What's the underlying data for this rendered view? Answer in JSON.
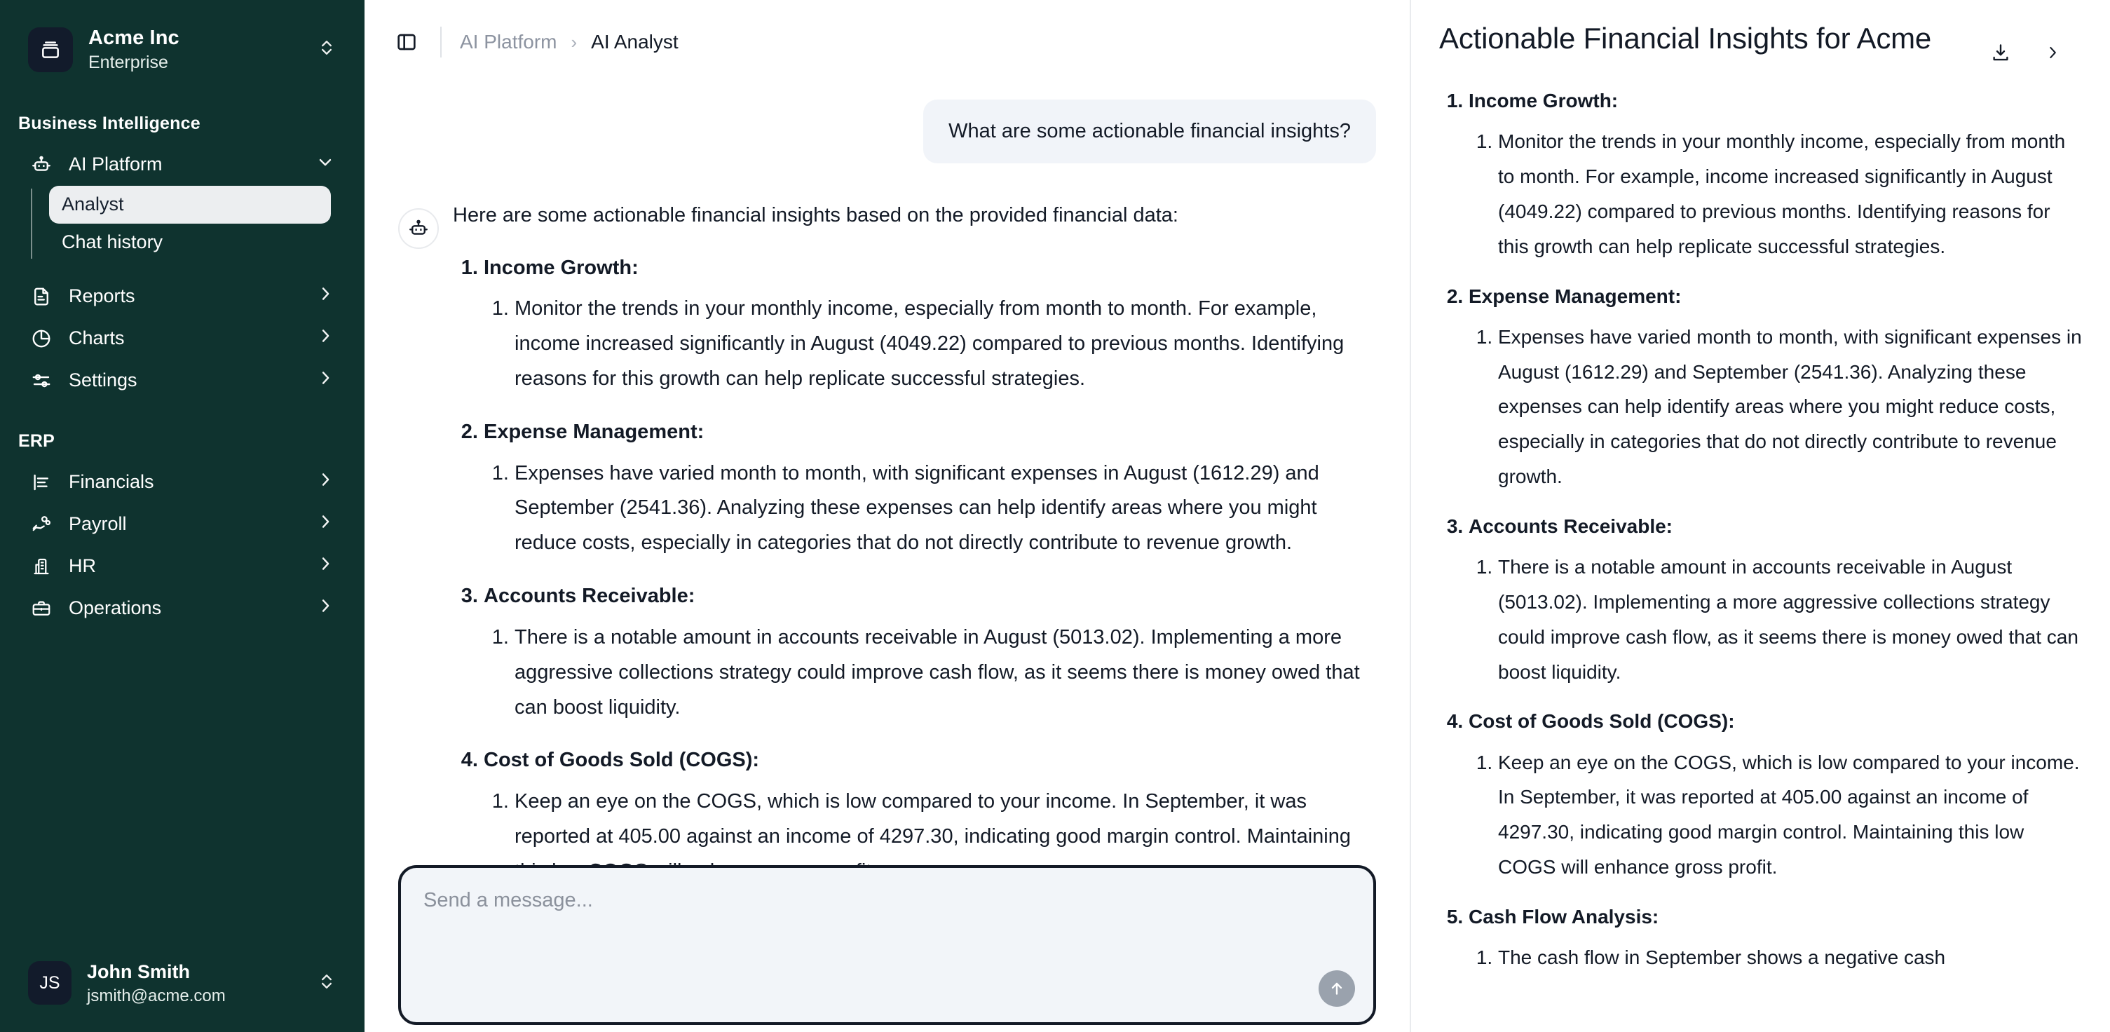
{
  "sidebar": {
    "org": {
      "name": "Acme Inc",
      "plan": "Enterprise",
      "logo_icon": "archive-box-icon",
      "switch_icon": "chevron-up-down-icon"
    },
    "sections": [
      {
        "label": "Business Intelligence",
        "items": [
          {
            "label": "AI Platform",
            "icon": "robot-icon",
            "chevron": "chevron-down-icon",
            "expanded": true,
            "children": [
              {
                "label": "Analyst",
                "active": true
              },
              {
                "label": "Chat history",
                "active": false
              }
            ]
          },
          {
            "label": "Reports",
            "icon": "document-icon",
            "chevron": "chevron-right-icon",
            "expanded": false
          },
          {
            "label": "Charts",
            "icon": "pie-chart-icon",
            "chevron": "chevron-right-icon",
            "expanded": false
          },
          {
            "label": "Settings",
            "icon": "sliders-icon",
            "chevron": "chevron-right-icon",
            "expanded": false
          }
        ]
      },
      {
        "label": "ERP",
        "items": [
          {
            "label": "Financials",
            "icon": "bar-chart-icon",
            "chevron": "chevron-right-icon",
            "expanded": false
          },
          {
            "label": "Payroll",
            "icon": "hand-coins-icon",
            "chevron": "chevron-right-icon",
            "expanded": false
          },
          {
            "label": "HR",
            "icon": "building-icon",
            "chevron": "chevron-right-icon",
            "expanded": false
          },
          {
            "label": "Operations",
            "icon": "briefcase-icon",
            "chevron": "chevron-right-icon",
            "expanded": false
          }
        ]
      }
    ],
    "user": {
      "initials": "JS",
      "name": "John Smith",
      "email": "jsmith@acme.com",
      "switch_icon": "chevron-up-down-icon"
    }
  },
  "topbar": {
    "panel_toggle_icon": "sidebar-panel-icon",
    "breadcrumb": {
      "parent": "AI Platform",
      "separator": "›",
      "current": "AI Analyst"
    }
  },
  "chat": {
    "user_message": "What are some actionable financial insights?",
    "bot_avatar_icon": "robot-icon",
    "bot_lead": "Here are some actionable financial insights based on the provided financial data:",
    "items": [
      {
        "heading": "Income Growth:",
        "detail": "Monitor the trends in your monthly income, especially from month to month. For example, income increased significantly in August (4049.22) compared to previous months. Identifying reasons for this growth can help replicate successful strategies."
      },
      {
        "heading": "Expense Management:",
        "detail": "Expenses have varied month to month, with significant expenses in August (1612.29) and September (2541.36). Analyzing these expenses can help identify areas where you might reduce costs, especially in categories that do not directly contribute to revenue growth."
      },
      {
        "heading": "Accounts Receivable:",
        "detail": "There is a notable amount in accounts receivable in August (5013.02). Implementing a more aggressive collections strategy could improve cash flow, as it seems there is money owed that can boost liquidity."
      },
      {
        "heading": "Cost of Goods Sold (COGS):",
        "detail": "Keep an eye on the COGS, which is low compared to your income. In September, it was reported at 405.00 against an income of 4297.30, indicating good margin control. Maintaining this low COGS will enhance gross profit."
      }
    ]
  },
  "composer": {
    "placeholder": "Send a message...",
    "value": "",
    "send_icon": "arrow-up-icon"
  },
  "right_panel": {
    "title": "Actionable Financial Insights for Acme",
    "download_icon": "download-icon",
    "collapse_icon": "chevron-right-icon",
    "items": [
      {
        "heading": "Income Growth:",
        "detail": "Monitor the trends in your monthly income, especially from month to month. For example, income increased significantly in August (4049.22) compared to previous months. Identifying reasons for this growth can help replicate successful strategies."
      },
      {
        "heading": "Expense Management:",
        "detail": "Expenses have varied month to month, with significant expenses in August (1612.29) and September (2541.36). Analyzing these expenses can help identify areas where you might reduce costs, especially in categories that do not directly contribute to revenue growth."
      },
      {
        "heading": "Accounts Receivable:",
        "detail": "There is a notable amount in accounts receivable in August (5013.02). Implementing a more aggressive collections strategy could improve cash flow, as it seems there is money owed that can boost liquidity."
      },
      {
        "heading": "Cost of Goods Sold (COGS):",
        "detail": "Keep an eye on the COGS, which is low compared to your income. In September, it was reported at 405.00 against an income of 4297.30, indicating good margin control. Maintaining this low COGS will enhance gross profit."
      },
      {
        "heading": "Cash Flow Analysis:",
        "detail": "The cash flow in September shows a negative cash"
      }
    ]
  },
  "colors": {
    "sidebar_bg": "#0f332f",
    "ink": "#131a26",
    "user_bubble_bg": "#f1f4f9",
    "composer_bg": "#f2f5f9",
    "active_item_bg": "#eceef0",
    "muted_text": "#8c93a0"
  }
}
